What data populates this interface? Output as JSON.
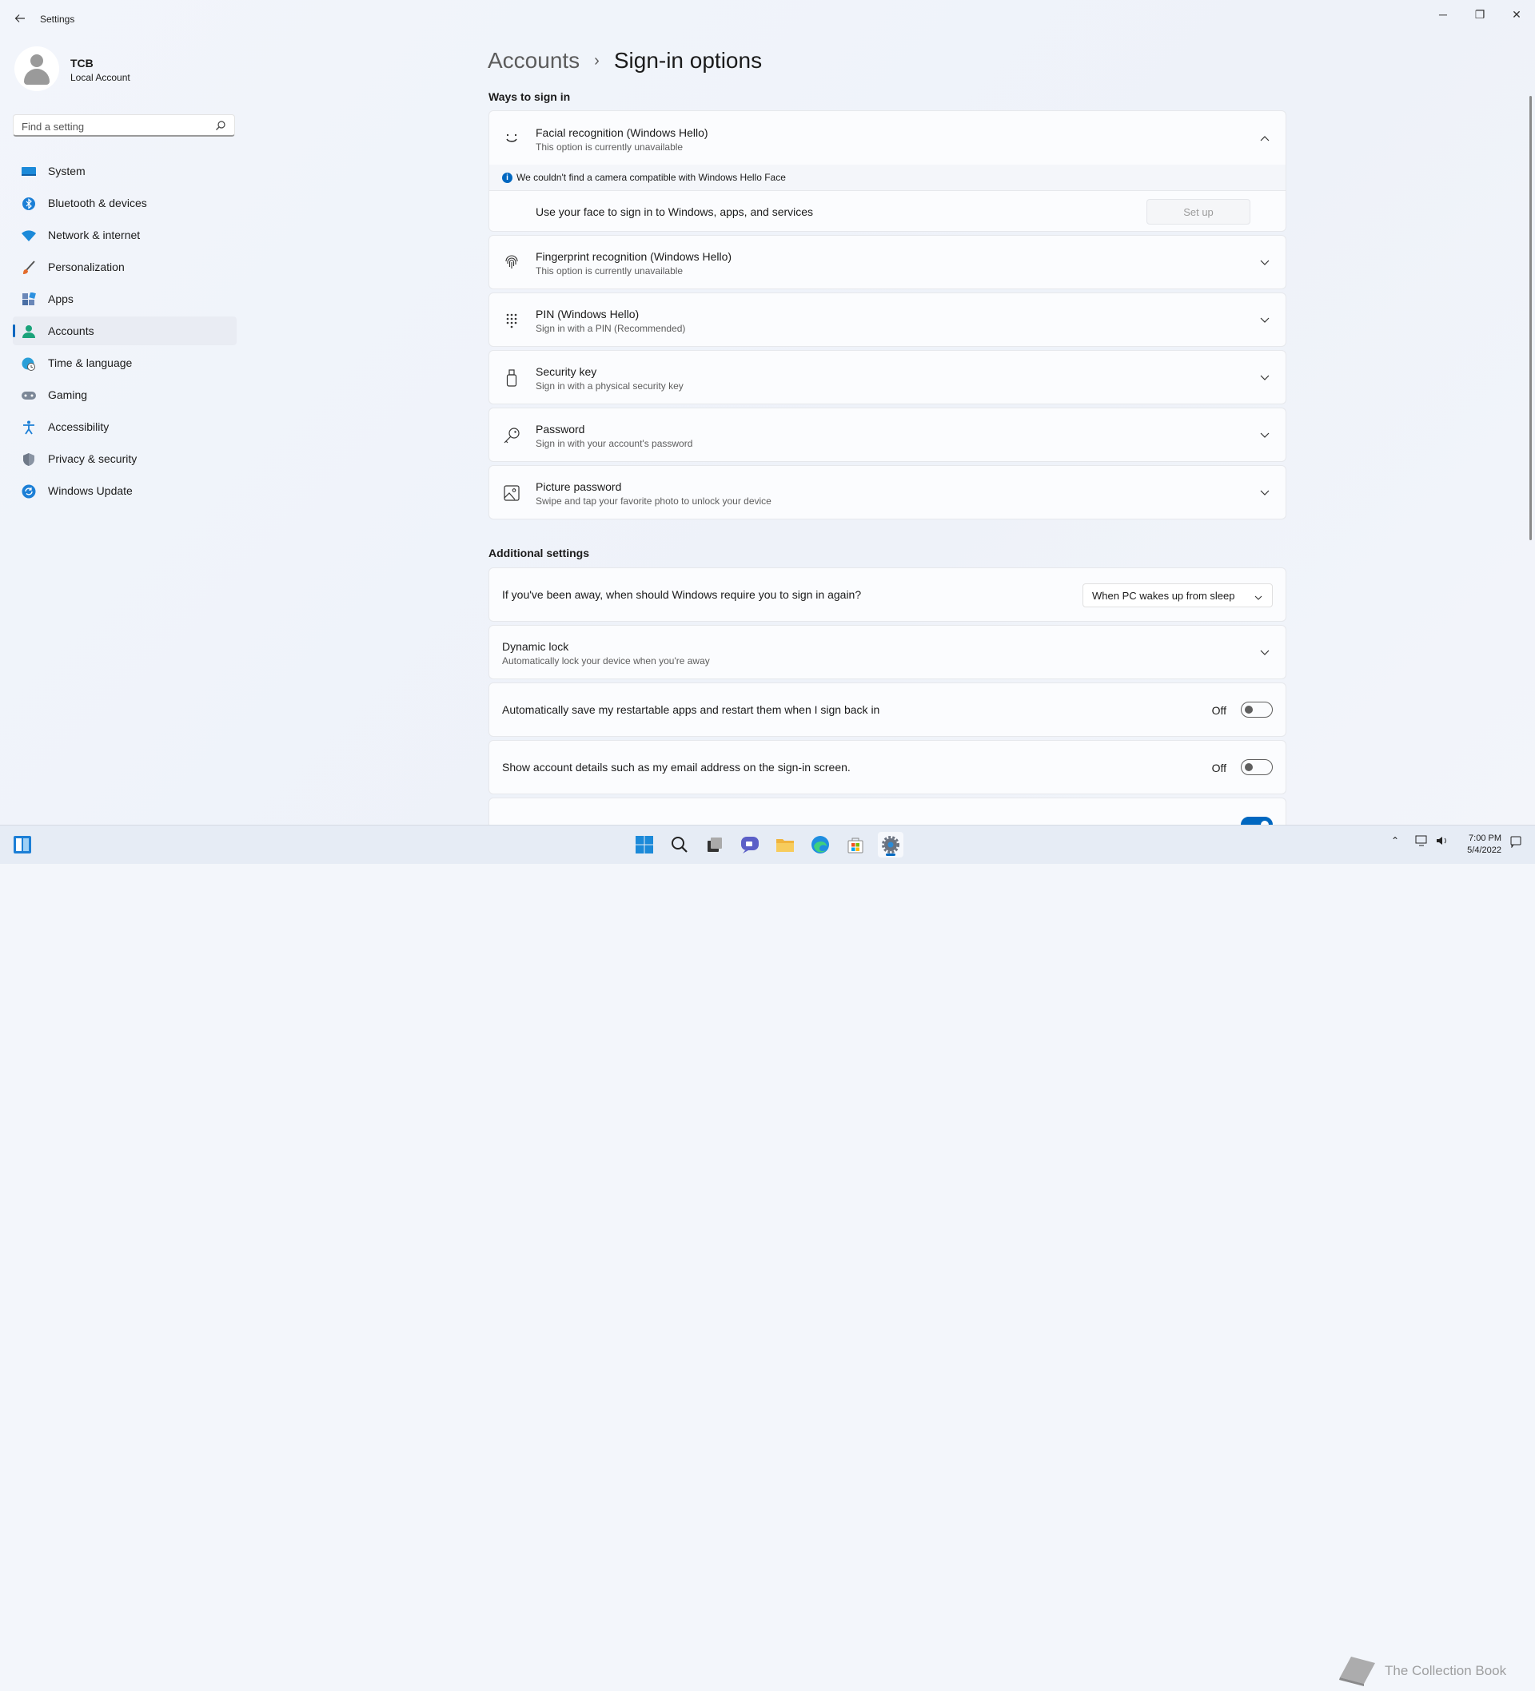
{
  "window": {
    "title": "Settings",
    "controls": {
      "minimize": "─",
      "maximize": "❐",
      "close": "✕"
    }
  },
  "profile": {
    "name": "TCB",
    "account_type": "Local Account"
  },
  "search": {
    "placeholder": "Find a setting",
    "icon": "search-icon"
  },
  "sidebar": {
    "items": [
      {
        "label": "System",
        "icon": "system-icon",
        "active": false
      },
      {
        "label": "Bluetooth & devices",
        "icon": "bluetooth-icon",
        "active": false
      },
      {
        "label": "Network & internet",
        "icon": "wifi-icon",
        "active": false
      },
      {
        "label": "Personalization",
        "icon": "brush-icon",
        "active": false
      },
      {
        "label": "Apps",
        "icon": "apps-icon",
        "active": false
      },
      {
        "label": "Accounts",
        "icon": "accounts-icon",
        "active": true
      },
      {
        "label": "Time & language",
        "icon": "globe-clock-icon",
        "active": false
      },
      {
        "label": "Gaming",
        "icon": "gamepad-icon",
        "active": false
      },
      {
        "label": "Accessibility",
        "icon": "accessibility-icon",
        "active": false
      },
      {
        "label": "Privacy & security",
        "icon": "shield-icon",
        "active": false
      },
      {
        "label": "Windows Update",
        "icon": "update-icon",
        "active": false
      }
    ]
  },
  "breadcrumb": {
    "parent": "Accounts",
    "separator": "›",
    "current": "Sign-in options"
  },
  "ways": {
    "title": "Ways to sign in",
    "facial": {
      "title": "Facial recognition (Windows Hello)",
      "subtitle": "This option is currently unavailable",
      "notice": "We couldn't find a camera compatible with Windows Hello Face",
      "info_glyph": "i",
      "description": "Use your face to sign in to Windows, apps, and services",
      "button": "Set up"
    },
    "fingerprint": {
      "title": "Fingerprint recognition (Windows Hello)",
      "subtitle": "This option is currently unavailable"
    },
    "pin": {
      "title": "PIN (Windows Hello)",
      "subtitle": "Sign in with a PIN (Recommended)"
    },
    "security_key": {
      "title": "Security key",
      "subtitle": "Sign in with a physical security key"
    },
    "password": {
      "title": "Password",
      "subtitle": "Sign in with your account's password"
    },
    "picture_password": {
      "title": "Picture password",
      "subtitle": "Swipe and tap your favorite photo to unlock your device"
    }
  },
  "additional": {
    "title": "Additional settings",
    "require_signin": {
      "label": "If you've been away, when should Windows require you to sign in again?",
      "value": "When PC wakes up from sleep"
    },
    "dynamic_lock": {
      "title": "Dynamic lock",
      "subtitle": "Automatically lock your device when you're away"
    },
    "restart_apps": {
      "label": "Automatically save my restartable apps and restart them when I sign back in",
      "state": "Off"
    },
    "account_details": {
      "label": "Show account details such as my email address on the sign-in screen.",
      "state": "Off"
    }
  },
  "taskbar": {
    "clock_time": "7:00 PM",
    "clock_date": "5/4/2022",
    "tray_caret": "⌃"
  },
  "watermark": {
    "text": "The Collection Book"
  },
  "colors": {
    "accent": "#0067c0",
    "background": "#f3f6fb",
    "card": "#fbfcfe"
  }
}
